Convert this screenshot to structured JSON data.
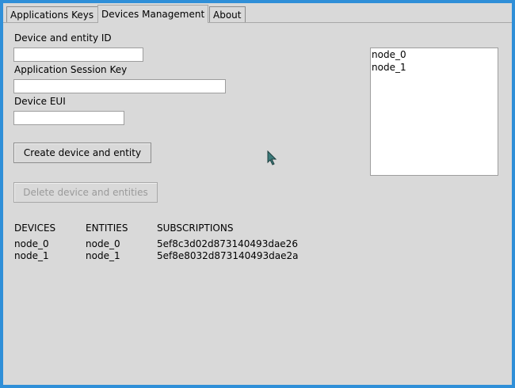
{
  "tabs": [
    "Applications Keys",
    "Devices Management",
    "About"
  ],
  "active_tab": "Devices Management",
  "form": {
    "device_entity_label": "Device and entity ID",
    "device_entity_value": "",
    "app_session_key_label": "Application Session Key",
    "app_session_key_value": "",
    "device_eui_label": "Device EUI",
    "device_eui_value": "",
    "create_button": "Create device and entity",
    "delete_button": "Delete device and entities"
  },
  "node_list": [
    "node_0",
    "node_1"
  ],
  "table": {
    "headers": [
      "DEVICES",
      "ENTITIES",
      "SUBSCRIPTIONS"
    ],
    "rows": [
      [
        "node_0",
        "node_0",
        "5ef8c3d02d873140493dae26"
      ],
      [
        "node_1",
        "node_1",
        "5ef8e8032d873140493dae2a"
      ]
    ]
  },
  "colors": {
    "desktop": "#2f8fd8",
    "window_bg": "#d9d9d9",
    "disabled_text": "#9a9a9a"
  }
}
